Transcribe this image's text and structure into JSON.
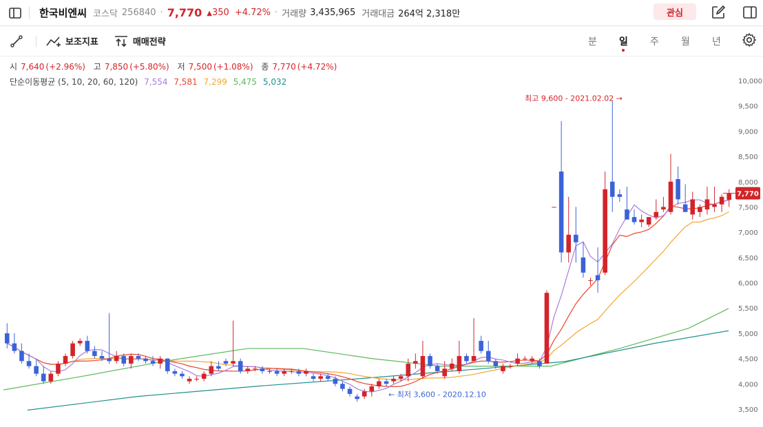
{
  "header": {
    "stock_name": "한국비엔씨",
    "market": "코스닥",
    "code": "256840",
    "price": "7,770",
    "change": "350",
    "change_pct": "+4.72%",
    "volume_label": "거래량",
    "volume": "3,435,965",
    "amount_label": "거래대금",
    "amount": "264억 2,318만",
    "favorite_label": "관심"
  },
  "toolbar": {
    "indicator_label": "보조지표",
    "strategy_label": "매매전략",
    "periods": [
      "분",
      "일",
      "주",
      "월",
      "년"
    ],
    "active_period": "일"
  },
  "ohlc": {
    "open_label": "시",
    "open": "7,640",
    "open_pct": "(+2.96%)",
    "high_label": "고",
    "high": "7,850",
    "high_pct": "(+5.80%)",
    "low_label": "저",
    "low": "7,500",
    "low_pct": "(+1.08%)",
    "close_label": "종",
    "close": "7,770",
    "close_pct": "(+4.72%)"
  },
  "ma": {
    "label": "단순이동평균 (5, 10, 20, 60, 120)",
    "values": [
      "7,554",
      "7,581",
      "7,299",
      "5,475",
      "5,032"
    ],
    "colors": [
      "#a77de0",
      "#e8452c",
      "#f0a830",
      "#5cb85c",
      "#1f8f8f"
    ]
  },
  "colors": {
    "up": "#d2242a",
    "down": "#3a63d8",
    "accent": "#d2242a"
  },
  "chart_data": {
    "type": "candlestick",
    "y_axis_ticks": [
      "10,000",
      "9,500",
      "9,000",
      "8,500",
      "8,000",
      "7,500",
      "7,000",
      "6,500",
      "6,000",
      "5,500",
      "5,000",
      "4,500",
      "4,000",
      "3,500"
    ],
    "ylim": [
      3400,
      10200
    ],
    "current_price_label": "7,770",
    "current_price": 7770,
    "high_annotation": "최고 9,600 - 2021.02.02",
    "high_value": 9600,
    "low_annotation": "최저 3,600 - 2020.12.10",
    "low_value": 3600,
    "candles": [
      [
        5000,
        5200,
        4700,
        4800
      ],
      [
        4800,
        5000,
        4600,
        4650
      ],
      [
        4650,
        4800,
        4400,
        4450
      ],
      [
        4450,
        4600,
        4300,
        4350
      ],
      [
        4350,
        4500,
        4150,
        4200
      ],
      [
        4200,
        4350,
        4000,
        4050
      ],
      [
        4050,
        4250,
        4000,
        4200
      ],
      [
        4200,
        4450,
        4150,
        4400
      ],
      [
        4400,
        4600,
        4350,
        4550
      ],
      [
        4550,
        4850,
        4500,
        4800
      ],
      [
        4800,
        4900,
        4750,
        4850
      ],
      [
        4850,
        4950,
        4600,
        4650
      ],
      [
        4650,
        4750,
        4500,
        4550
      ],
      [
        4550,
        4650,
        4450,
        4500
      ],
      [
        4500,
        5400,
        4400,
        4450
      ],
      [
        4450,
        4650,
        4400,
        4550
      ],
      [
        4550,
        4600,
        4350,
        4400
      ],
      [
        4400,
        4600,
        4300,
        4550
      ],
      [
        4550,
        4600,
        4450,
        4500
      ],
      [
        4500,
        4550,
        4400,
        4450
      ],
      [
        4450,
        4550,
        4350,
        4400
      ],
      [
        4400,
        4550,
        4300,
        4500
      ],
      [
        4500,
        4500,
        4200,
        4250
      ],
      [
        4250,
        4300,
        4150,
        4200
      ],
      [
        4200,
        4250,
        4100,
        4150
      ],
      [
        4050,
        4150,
        4000,
        4100
      ],
      [
        4100,
        4150,
        4050,
        4100
      ],
      [
        4100,
        4250,
        4050,
        4200
      ],
      [
        4200,
        4450,
        4150,
        4350
      ],
      [
        4350,
        4450,
        4250,
        4300
      ],
      [
        4450,
        4500,
        4350,
        4400
      ],
      [
        4400,
        5250,
        4350,
        4450
      ],
      [
        4450,
        4500,
        4200,
        4250
      ],
      [
        4250,
        4350,
        4200,
        4300
      ],
      [
        4300,
        4350,
        4250,
        4300
      ],
      [
        4300,
        4350,
        4200,
        4250
      ],
      [
        4250,
        4300,
        4200,
        4250
      ],
      [
        4250,
        4300,
        4150,
        4200
      ],
      [
        4200,
        4300,
        4150,
        4250
      ],
      [
        4250,
        4300,
        4200,
        4250
      ],
      [
        4250,
        4300,
        4150,
        4200
      ],
      [
        4200,
        4300,
        4150,
        4250
      ],
      [
        4150,
        4200,
        4050,
        4100
      ],
      [
        4100,
        4200,
        4050,
        4150
      ],
      [
        4150,
        4200,
        4050,
        4100
      ],
      [
        4100,
        4150,
        3950,
        4000
      ],
      [
        4000,
        4050,
        3850,
        3900
      ],
      [
        3900,
        3950,
        3750,
        3800
      ],
      [
        3750,
        3800,
        3650,
        3700
      ],
      [
        3750,
        3900,
        3700,
        3850
      ],
      [
        3850,
        4000,
        3750,
        3950
      ],
      [
        3950,
        4100,
        3900,
        4050
      ],
      [
        4050,
        4100,
        3950,
        4000
      ],
      [
        4050,
        4150,
        4000,
        4100
      ],
      [
        4100,
        4200,
        4050,
        4150
      ],
      [
        4150,
        4500,
        4050,
        4400
      ],
      [
        4400,
        4600,
        4300,
        4450
      ],
      [
        4150,
        4850,
        4100,
        4550
      ],
      [
        4550,
        4600,
        4300,
        4350
      ],
      [
        4350,
        4400,
        4200,
        4250
      ],
      [
        4150,
        4450,
        4100,
        4300
      ],
      [
        4300,
        4500,
        4250,
        4400
      ],
      [
        4250,
        4850,
        4200,
        4550
      ],
      [
        4550,
        4600,
        4400,
        4450
      ],
      [
        4450,
        5300,
        4450,
        4550
      ],
      [
        4850,
        4950,
        4600,
        4650
      ],
      [
        4650,
        4850,
        4400,
        4450
      ],
      [
        4450,
        4500,
        4300,
        4350
      ],
      [
        4250,
        4400,
        4200,
        4350
      ],
      [
        4350,
        4400,
        4300,
        4350
      ],
      [
        4400,
        4600,
        4350,
        4500
      ],
      [
        4500,
        4550,
        4450,
        4500
      ],
      [
        4450,
        4550,
        4400,
        4500
      ],
      [
        4450,
        4500,
        4300,
        4350
      ],
      [
        4400,
        5850,
        4400,
        5800
      ],
      [
        7500,
        7500,
        7500,
        7500
      ],
      [
        8200,
        9200,
        6400,
        6600
      ],
      [
        6600,
        7700,
        6400,
        6950
      ],
      [
        6950,
        7500,
        6400,
        6800
      ],
      [
        6500,
        6800,
        6100,
        6200
      ],
      [
        6050,
        6100,
        5950,
        6050
      ],
      [
        6150,
        6700,
        5800,
        6050
      ],
      [
        6200,
        8200,
        6150,
        7850
      ],
      [
        8000,
        9600,
        7400,
        7700
      ],
      [
        7750,
        7850,
        7600,
        7700
      ],
      [
        7450,
        7900,
        7350,
        7250
      ],
      [
        7300,
        7450,
        7150,
        7200
      ],
      [
        7200,
        7350,
        7100,
        7250
      ],
      [
        7150,
        7300,
        7100,
        7300
      ],
      [
        7300,
        7650,
        7250,
        7400
      ],
      [
        7450,
        7700,
        7400,
        7500
      ],
      [
        7400,
        8550,
        7350,
        8000
      ],
      [
        8050,
        8300,
        7550,
        7650
      ],
      [
        7550,
        7950,
        7400,
        7400
      ],
      [
        7350,
        7800,
        7250,
        7650
      ],
      [
        7400,
        7550,
        7300,
        7500
      ],
      [
        7450,
        7900,
        7350,
        7650
      ],
      [
        7500,
        7900,
        7400,
        7550
      ],
      [
        7550,
        7750,
        7400,
        7700
      ],
      [
        7640,
        7850,
        7500,
        7770
      ]
    ]
  }
}
